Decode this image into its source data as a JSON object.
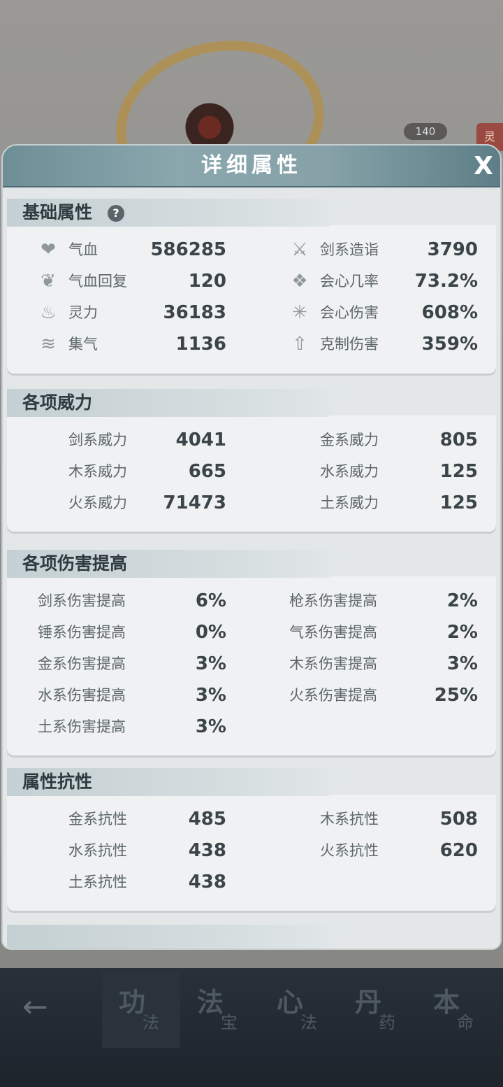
{
  "background": {
    "badge": "140",
    "side_tag": "灵"
  },
  "modal": {
    "title": "详细属性",
    "close_label": "X"
  },
  "sections": {
    "basic": {
      "title": "基础属性",
      "help": "?",
      "left": [
        {
          "icon": "heart-icon",
          "label": "气血",
          "value": "586285"
        },
        {
          "icon": "regen-icon",
          "label": "气血回复",
          "value": "120"
        },
        {
          "icon": "flame-icon",
          "label": "灵力",
          "value": "36183"
        },
        {
          "icon": "swirl-icon",
          "label": "集气",
          "value": "1136"
        }
      ],
      "right": [
        {
          "icon": "sword-icon",
          "label": "剑系造诣",
          "value": "3790"
        },
        {
          "icon": "crit-rate-icon",
          "label": "会心几率",
          "value": "73.2%"
        },
        {
          "icon": "crit-damage-icon",
          "label": "会心伤害",
          "value": "608%"
        },
        {
          "icon": "counter-icon",
          "label": "克制伤害",
          "value": "359%"
        }
      ]
    },
    "power": {
      "title": "各项威力",
      "left": [
        {
          "label": "剑系威力",
          "value": "4041"
        },
        {
          "label": "木系威力",
          "value": "665"
        },
        {
          "label": "火系威力",
          "value": "71473"
        }
      ],
      "right": [
        {
          "label": "金系威力",
          "value": "805"
        },
        {
          "label": "水系威力",
          "value": "125"
        },
        {
          "label": "土系威力",
          "value": "125"
        }
      ]
    },
    "damage": {
      "title": "各项伤害提高",
      "left": [
        {
          "label": "剑系伤害提高",
          "value": "6%"
        },
        {
          "label": "锤系伤害提高",
          "value": "0%"
        },
        {
          "label": "金系伤害提高",
          "value": "3%"
        },
        {
          "label": "水系伤害提高",
          "value": "3%"
        },
        {
          "label": "土系伤害提高",
          "value": "3%"
        }
      ],
      "right": [
        {
          "label": "枪系伤害提高",
          "value": "2%"
        },
        {
          "label": "气系伤害提高",
          "value": "2%"
        },
        {
          "label": "木系伤害提高",
          "value": "3%"
        },
        {
          "label": "火系伤害提高",
          "value": "25%"
        }
      ]
    },
    "resist": {
      "title": "属性抗性",
      "left": [
        {
          "label": "金系抗性",
          "value": "485"
        },
        {
          "label": "水系抗性",
          "value": "438"
        },
        {
          "label": "土系抗性",
          "value": "438"
        }
      ],
      "right": [
        {
          "label": "木系抗性",
          "value": "508"
        },
        {
          "label": "火系抗性",
          "value": "620"
        }
      ]
    }
  },
  "bottom_nav": {
    "back_icon": "back-arrow-icon",
    "tabs": [
      {
        "big": "功",
        "small": "法"
      },
      {
        "big": "法",
        "small": "宝"
      },
      {
        "big": "心",
        "small": "法"
      },
      {
        "big": "丹",
        "small": "药"
      },
      {
        "big": "本",
        "small": "命"
      }
    ]
  }
}
